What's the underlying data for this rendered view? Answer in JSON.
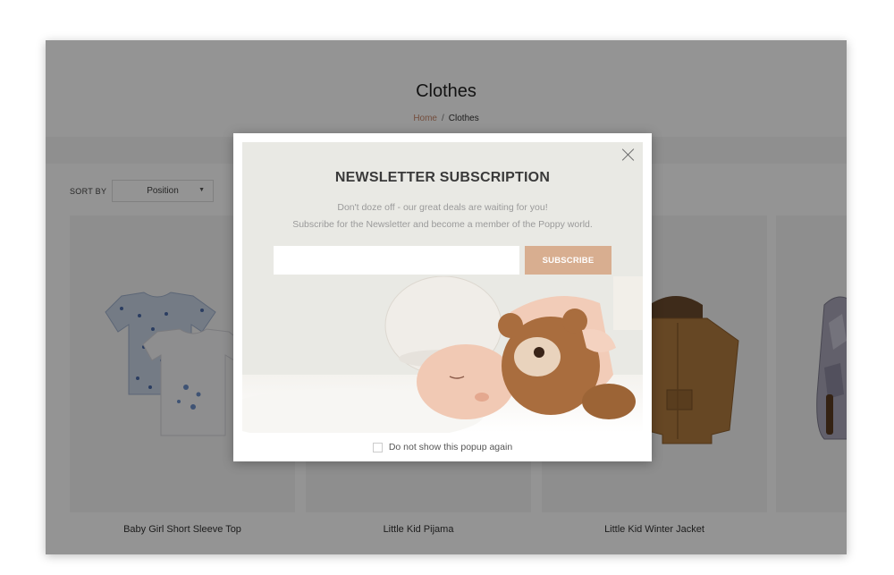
{
  "category": {
    "title": "Clothes",
    "breadcrumb": {
      "home": "Home",
      "separator": "/",
      "current": "Clothes"
    }
  },
  "toolbar": {
    "sort_label": "SORT BY",
    "sort_value": "Position",
    "sort_caret": "▼"
  },
  "products": [
    {
      "name": "Baby Girl Short Sleeve Top"
    },
    {
      "name": "Little Kid Pijama"
    },
    {
      "name": "Little Kid Winter Jacket"
    }
  ],
  "popup": {
    "title": "NEWSLETTER SUBSCRIPTION",
    "line1": "Don't doze off - our great deals are waiting for you!",
    "line2": "Subscribe for the Newsletter and become a member of the Poppy world.",
    "email_placeholder": "",
    "subscribe_label": "SUBSCRIBE",
    "dont_show_label": "Do not show this popup again"
  },
  "colors": {
    "accent": "#d8ae90",
    "breadcrumb_home": "#c8876a",
    "popup_bg": "#e9e9e4"
  }
}
